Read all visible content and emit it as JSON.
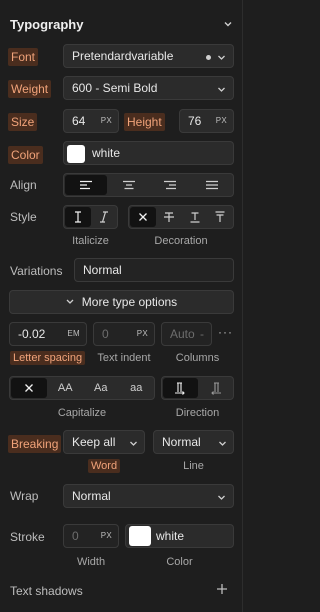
{
  "header": {
    "title": "Typography",
    "collapse_icon": "chevron-down-icon"
  },
  "font": {
    "label": "Font",
    "value": "Pretendardvariable"
  },
  "weight": {
    "label": "Weight",
    "value": "600 - Semi Bold"
  },
  "size": {
    "label": "Size",
    "value": "64",
    "unit": "PX"
  },
  "height": {
    "label": "Height",
    "value": "76",
    "unit": "PX"
  },
  "color": {
    "label": "Color",
    "value": "white",
    "swatch": "#ffffff"
  },
  "align": {
    "label": "Align",
    "options": [
      "align-left-icon",
      "align-center-icon",
      "align-right-icon",
      "align-justify-icon"
    ],
    "selected": 0
  },
  "style": {
    "label": "Style",
    "italicize_caption": "Italicize",
    "decoration_caption": "Decoration"
  },
  "variations": {
    "label": "Variations",
    "value": "Normal"
  },
  "more_options": {
    "label": "More type options"
  },
  "spacing": {
    "letter_value": "-0.02",
    "letter_unit": "EM",
    "letter_caption": "Letter spacing",
    "indent_placeholder": "0",
    "indent_unit": "PX",
    "indent_caption": "Text indent",
    "columns_placeholder": "Auto",
    "columns_caption": "Columns"
  },
  "capitalize": {
    "caption": "Capitalize",
    "options": [
      "AA",
      "Aa",
      "aa"
    ]
  },
  "direction": {
    "caption": "Direction"
  },
  "breaking": {
    "label": "Breaking",
    "word_value": "Keep all",
    "word_caption": "Word",
    "line_value": "Normal",
    "line_caption": "Line"
  },
  "wrap": {
    "label": "Wrap",
    "value": "Normal"
  },
  "stroke": {
    "label": "Stroke",
    "width_placeholder": "0",
    "width_unit": "PX",
    "width_caption": "Width",
    "color_value": "white",
    "color_caption": "Color",
    "swatch": "#ffffff"
  },
  "text_shadows": {
    "label": "Text shadows"
  }
}
